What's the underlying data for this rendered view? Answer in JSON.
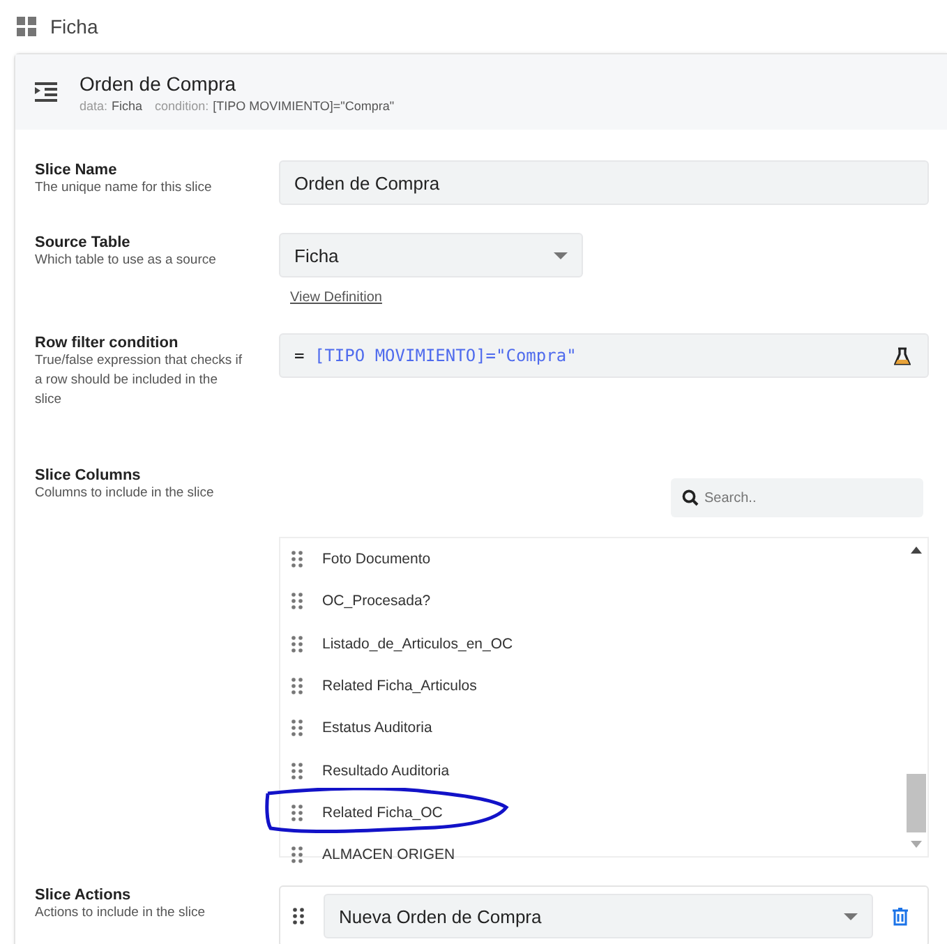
{
  "topbar": {
    "title": "Ficha"
  },
  "header": {
    "title": "Orden de Compra",
    "meta": [
      {
        "label": "data:",
        "value": "Ficha"
      },
      {
        "label": "condition:",
        "value": "[TIPO MOVIMIENTO]=\"Compra\""
      }
    ]
  },
  "slice_name": {
    "label": "Slice Name",
    "hint": "The unique name for this slice",
    "value": "Orden de Compra"
  },
  "source_table": {
    "label": "Source Table",
    "hint": "Which table to use as a source",
    "value": "Ficha",
    "link": "View Definition"
  },
  "row_filter": {
    "label": "Row filter condition",
    "hint": "True/false expression that checks if a row should be included in the slice",
    "prefix": "=",
    "expression": "[TIPO MOVIMIENTO]=\"Compra\""
  },
  "slice_columns": {
    "label": "Slice Columns",
    "hint": "Columns to include in the slice",
    "search": {
      "placeholder": "Search.."
    },
    "items": [
      {
        "name": "Foto Documento",
        "circled": false
      },
      {
        "name": "OC_Procesada?",
        "circled": false
      },
      {
        "name": "Listado_de_Articulos_en_OC",
        "circled": false
      },
      {
        "name": "Related Ficha_Articulos",
        "circled": false
      },
      {
        "name": "Estatus Auditoria",
        "circled": false
      },
      {
        "name": "Resultado Auditoria",
        "circled": false
      },
      {
        "name": "Related Ficha_OC",
        "circled": true
      },
      {
        "name": "ALMACEN ORIGEN",
        "circled": false
      }
    ]
  },
  "slice_actions": {
    "label": "Slice Actions",
    "hint": "Actions to include in the slice",
    "items": [
      {
        "value": "Nueva Orden de Compra"
      }
    ]
  }
}
